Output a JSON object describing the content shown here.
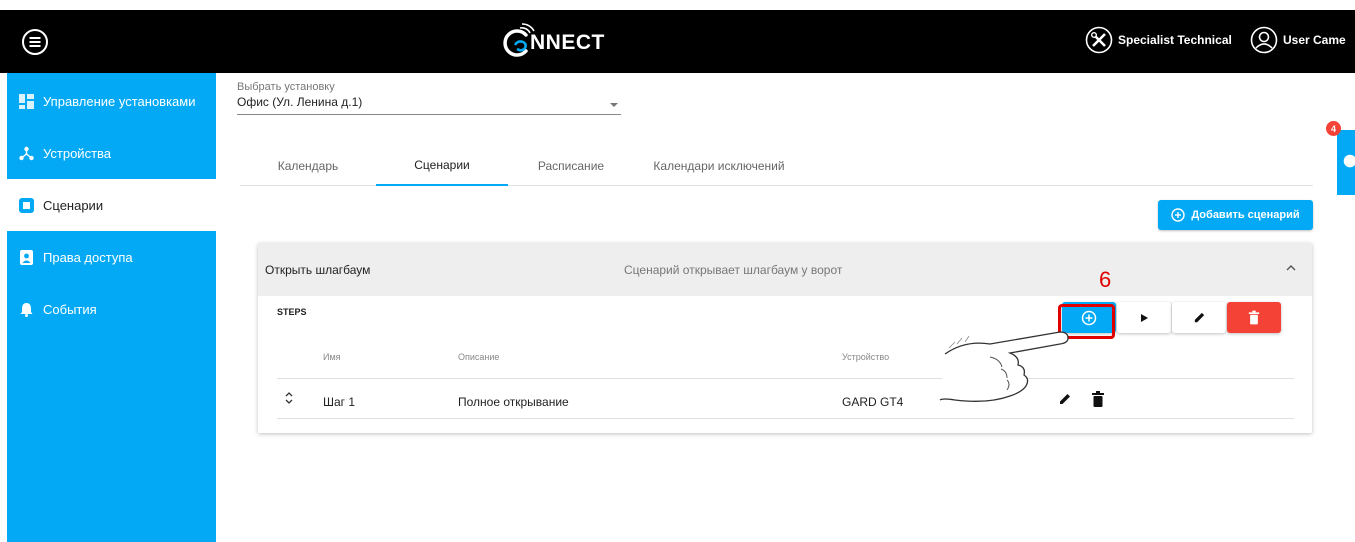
{
  "header": {
    "logo_text": "NNECT",
    "specialist_label": "Specialist Technical",
    "user_label": "User Came"
  },
  "sidebar": {
    "items": [
      {
        "label": "Управление установками",
        "icon": "dashboard-icon",
        "active": false
      },
      {
        "label": "Устройства",
        "icon": "devices-icon",
        "active": false
      },
      {
        "label": "Сценарии",
        "icon": "scenarios-icon",
        "active": true
      },
      {
        "label": "Права доступа",
        "icon": "access-rights-icon",
        "active": false
      },
      {
        "label": "События",
        "icon": "bell-icon",
        "active": false
      }
    ]
  },
  "installation_select": {
    "label": "Выбрать установку",
    "value": "Офис (Ул. Ленина д.1)"
  },
  "tabs": [
    {
      "label": "Календарь",
      "active": false
    },
    {
      "label": "Сценарии",
      "active": true
    },
    {
      "label": "Расписание",
      "active": false
    },
    {
      "label": "Календари исключений",
      "active": false
    }
  ],
  "add_scenario_label": "Добавить сценарий",
  "scenario": {
    "title": "Открыть шлагбаум",
    "description": "Сценарий открывает шлагбаум у ворот",
    "steps_label": "STEPS",
    "columns": [
      "Имя",
      "Описание",
      "Устройство"
    ],
    "rows": [
      {
        "name": "Шаг 1",
        "description": "Полное открывание",
        "device": "GARD GT4"
      }
    ]
  },
  "callout_number": "6",
  "notification_count": "4",
  "colors": {
    "accent": "#03a9f4",
    "danger": "#f44336",
    "header_bg": "#000000",
    "callout": "#e00000"
  }
}
